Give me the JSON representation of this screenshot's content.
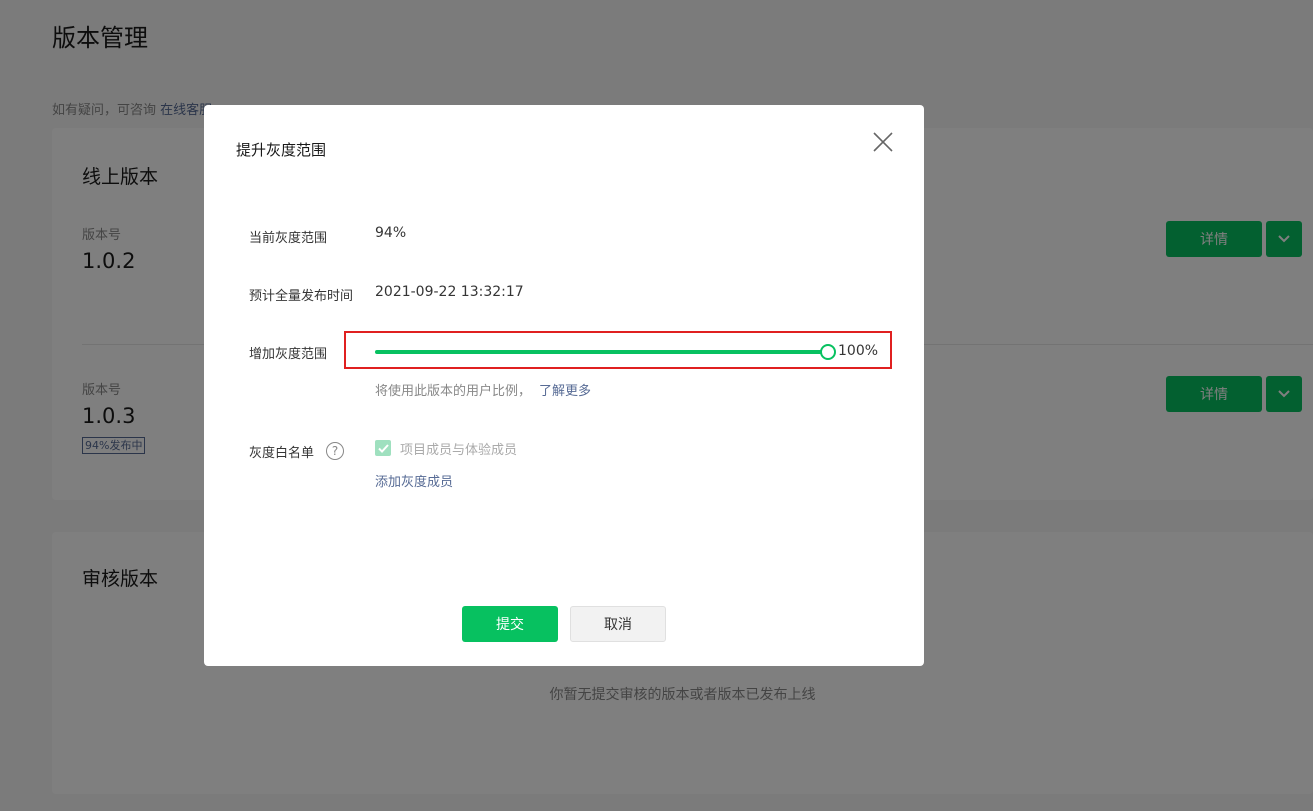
{
  "page": {
    "title": "版本管理",
    "help_prefix": "如有疑问，可咨询",
    "help_link": "在线客服"
  },
  "online": {
    "title": "线上版本",
    "versions": [
      {
        "label": "版本号",
        "number": "1.0.2",
        "detail_label": "详情"
      },
      {
        "label": "版本号",
        "number": "1.0.3",
        "badge": "94%发布中",
        "detail_label": "详情"
      }
    ]
  },
  "review": {
    "title": "审核版本",
    "empty": "你暂无提交审核的版本或者版本已发布上线"
  },
  "modal": {
    "title": "提升灰度范围",
    "current_label": "当前灰度范围",
    "current_value": "94%",
    "time_label": "预计全量发布时间",
    "time_value": "2021-09-22 13:32:17",
    "increase_label": "增加灰度范围",
    "slider_value": 100,
    "slider_text": "100%",
    "hint": "将使用此版本的用户比例，",
    "hint_link": "了解更多",
    "whitelist_label": "灰度白名单",
    "whitelist_help": "?",
    "checkbox_label": "项目成员与体验成员",
    "checkbox_checked": true,
    "add_link": "添加灰度成员",
    "submit": "提交",
    "cancel": "取消"
  },
  "colors": {
    "accent": "#07c160",
    "link": "#576b95",
    "highlight": "#e02020"
  }
}
